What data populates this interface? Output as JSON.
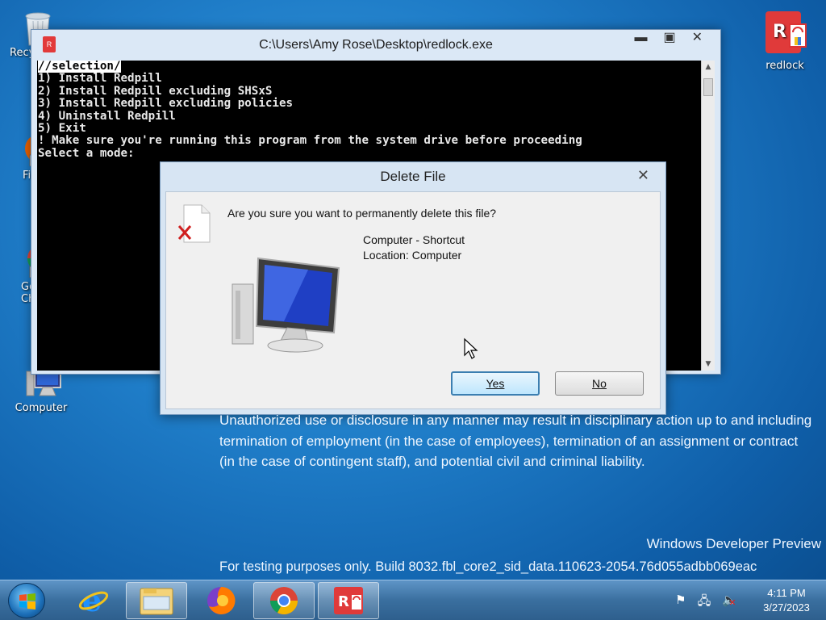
{
  "desktop": {
    "icons": [
      {
        "label": "Recy"
      },
      {
        "label": "Fi"
      },
      {
        "label": "Go"
      },
      {
        "label": "Ch"
      },
      {
        "label": "Computer"
      },
      {
        "label": "redlock"
      }
    ]
  },
  "console": {
    "title": "C:\\Users\\Amy Rose\\Desktop\\redlock.exe",
    "minimize": "▬",
    "maximize": "▣",
    "close": "✕",
    "lines": [
      "//selection/",
      "1) Install Redpill",
      "2) Install Redpill excluding SHSxS",
      "3) Install Redpill excluding policies",
      "4) Uninstall Redpill",
      "5) Exit",
      "",
      "! Make sure you're running this program from the system drive before proceeding",
      "",
      "Select a mode:"
    ]
  },
  "dialog": {
    "title": "Delete File",
    "close": "✕",
    "question": "Are you sure you want to permanently delete this file?",
    "item_name": "Computer - Shortcut",
    "item_location": "Location: Computer",
    "yes_label": "Yes",
    "no_label": "No"
  },
  "legal_text": "Unauthorized use or disclosure in any manner may result in disciplinary action up to and including termination of employment (in the case of employees), termination of an assignment or contract (in the case of contingent staff), and potential civil and criminal liability.",
  "watermark": {
    "edition": "Windows Developer Preview",
    "build": "For testing purposes only. Build 8032.fbl_core2_sid_data.110623-2054.76d055adbb069eac"
  },
  "taskbar": {
    "items": [
      "internet-explorer",
      "file-explorer",
      "firefox",
      "chrome",
      "redlock"
    ],
    "time": "4:11 PM",
    "date": "3/27/2023"
  }
}
